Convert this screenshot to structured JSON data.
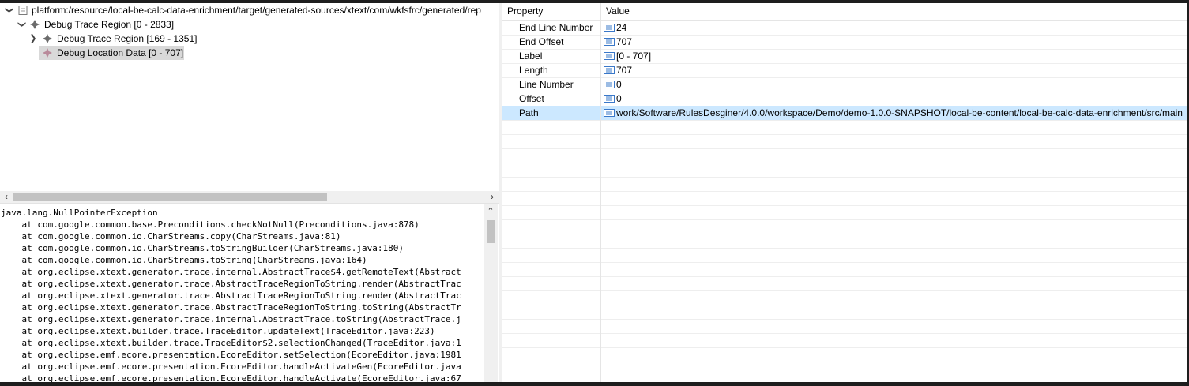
{
  "tree": {
    "root": {
      "label": "platform:/resource/local-be-calc-data-enrichment/target/generated-sources/xtext/com/wkfsfrc/generated/rep",
      "icon": "file-icon",
      "expanded": true
    },
    "nodes": [
      {
        "label": "Debug Trace Region [0 - 2833]",
        "icon": "trace-region-icon",
        "expanded": true
      },
      {
        "label": "Debug Trace Region [169 - 1351]",
        "icon": "trace-region-icon",
        "expanded": false
      },
      {
        "label": "Debug Location Data [0 - 707]",
        "icon": "location-data-icon",
        "selected": true
      }
    ]
  },
  "console": {
    "lines": [
      "java.lang.NullPointerException",
      "    at com.google.common.base.Preconditions.checkNotNull(Preconditions.java:878)",
      "    at com.google.common.io.CharStreams.copy(CharStreams.java:81)",
      "    at com.google.common.io.CharStreams.toStringBuilder(CharStreams.java:180)",
      "    at com.google.common.io.CharStreams.toString(CharStreams.java:164)",
      "    at org.eclipse.xtext.generator.trace.internal.AbstractTrace$4.getRemoteText(Abstract",
      "    at org.eclipse.xtext.generator.trace.AbstractTraceRegionToString.render(AbstractTrac",
      "    at org.eclipse.xtext.generator.trace.AbstractTraceRegionToString.render(AbstractTrac",
      "    at org.eclipse.xtext.generator.trace.AbstractTraceRegionToString.toString(AbstractTr",
      "    at org.eclipse.xtext.generator.trace.internal.AbstractTrace.toString(AbstractTrace.j",
      "    at org.eclipse.xtext.builder.trace.TraceEditor.updateText(TraceEditor.java:223)",
      "    at org.eclipse.xtext.builder.trace.TraceEditor$2.selectionChanged(TraceEditor.java:1",
      "    at org.eclipse.emf.ecore.presentation.EcoreEditor.setSelection(EcoreEditor.java:1981",
      "    at org.eclipse.emf.ecore.presentation.EcoreEditor.handleActivateGen(EcoreEditor.java",
      "    at org.eclipse.emf.ecore.presentation.EcoreEditor.handleActivate(EcoreEditor.java:67"
    ]
  },
  "properties": {
    "header": {
      "property": "Property",
      "value": "Value"
    },
    "rows": [
      {
        "name": "End Line Number",
        "value": "24"
      },
      {
        "name": "End Offset",
        "value": "707"
      },
      {
        "name": "Label",
        "value": "[0 - 707]"
      },
      {
        "name": "Length",
        "value": "707"
      },
      {
        "name": "Line Number",
        "value": "0"
      },
      {
        "name": "Offset",
        "value": "0"
      },
      {
        "name": "Path",
        "value": "work/Software/RulesDesginer/4.0.0/workspace/Demo/demo-1.0.0-SNAPSHOT/local-be-content/local-be-calc-data-enrichment/src/main",
        "selected": true
      }
    ]
  },
  "colors": {
    "selection_blue": "#cce8ff",
    "tree_selection": "#d9d9d9",
    "frame_dark": "#1e1e1e"
  }
}
